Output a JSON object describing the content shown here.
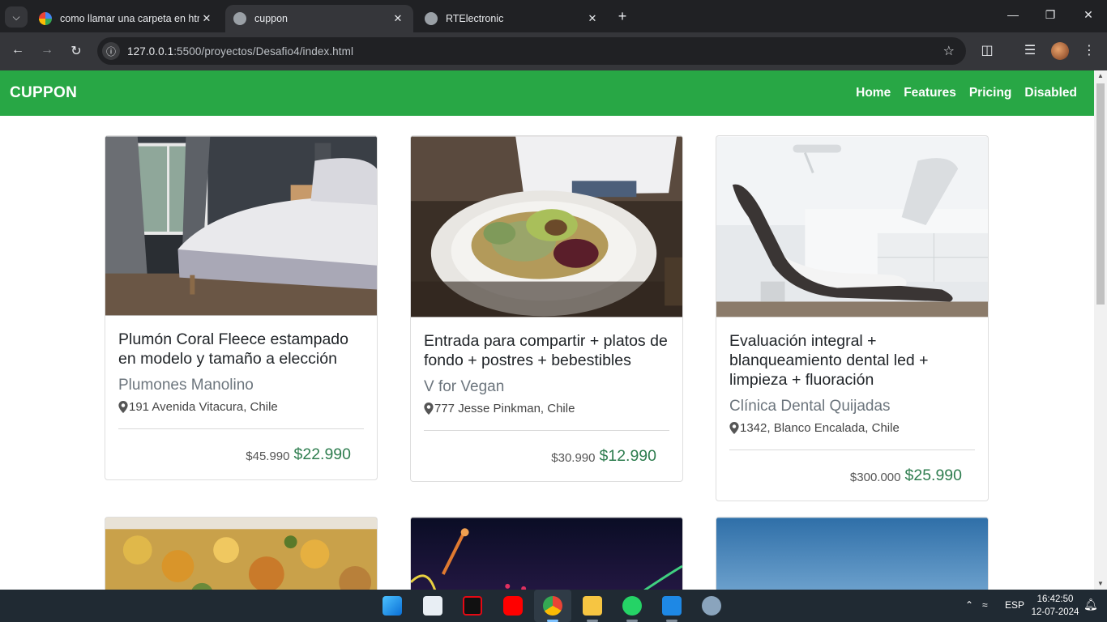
{
  "browser": {
    "tabs": [
      {
        "title": "como llamar una carpeta en htm",
        "active": false
      },
      {
        "title": "cuppon",
        "active": true
      },
      {
        "title": "RTElectronic",
        "active": false
      }
    ],
    "url_host": "127.0.0.1",
    "url_path": ":5500/proyectos/Desafio4/index.html"
  },
  "site": {
    "brand": "CUPPON",
    "nav": [
      "Home",
      "Features",
      "Pricing",
      "Disabled"
    ],
    "accent": "#28a745"
  },
  "cards": [
    {
      "title": "Plumón Coral Fleece estampado en modelo y tamaño a elección",
      "merchant": "Plumones Manolino",
      "address": "191 Avenida Vitacura, Chile",
      "old_price": "$45.990",
      "new_price": "$22.990"
    },
    {
      "title": "Entrada para compartir + platos de fondo + postres + bebestibles",
      "merchant": "V for Vegan",
      "address": "777 Jesse Pinkman, Chile",
      "old_price": "$30.990",
      "new_price": "$12.990"
    },
    {
      "title": "Evaluación integral + blanqueamiento dental led + limpieza + fluoración",
      "merchant": "Clínica Dental Quijadas",
      "address": "1342, Blanco Encalada, Chile",
      "old_price": "$300.000",
      "new_price": "$25.990"
    }
  ],
  "taskbar": {
    "language": "ESP",
    "time": "16:42:50",
    "date": "12-07-2024"
  }
}
